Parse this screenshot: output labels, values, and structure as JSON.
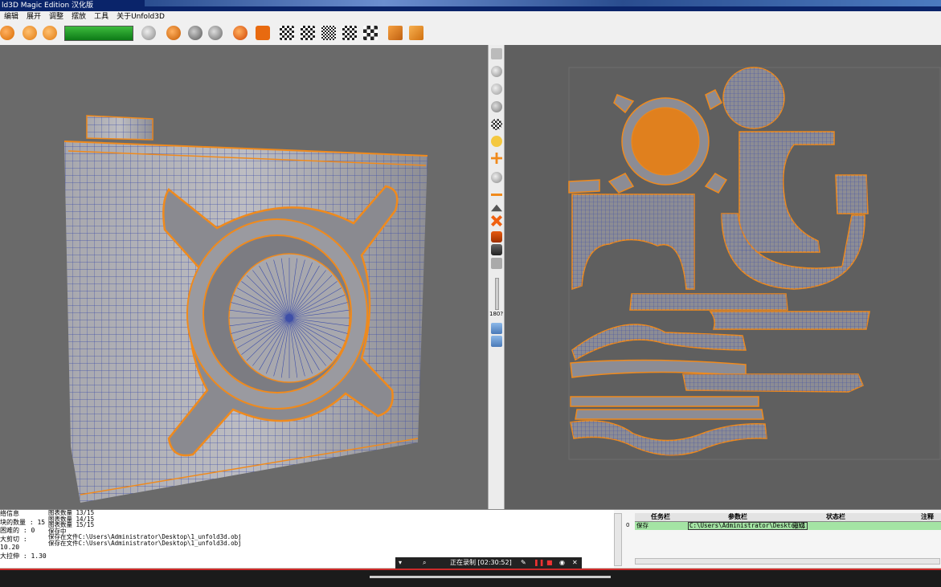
{
  "app": {
    "title": "ld3D Magic Edition 汉化版"
  },
  "menu": [
    "编辑",
    "展开",
    "调整",
    "摆放",
    "工具",
    "关于Unfold3D"
  ],
  "toolbar": {
    "progress_percent": 100
  },
  "sidebar": {
    "zoom_label": "180?"
  },
  "stats": {
    "lines": [
      "络信息",
      "块的数量 : 15",
      "困难的 : 0",
      "大剪切 : 10.20",
      "大拉伸 : 1.30"
    ]
  },
  "log": {
    "lines": [
      "图表数量  13/15",
      "图表数量  14/15",
      "图表数量  15/15",
      "保存中",
      "保存在文件C:\\Users\\Administrator\\Desktop\\1_unfold3d.obj",
      "保存在文件C:\\Users\\Administrator\\Desktop\\1_unfold3d.obj"
    ]
  },
  "tasks": {
    "headers": [
      "任务栏",
      "参数栏",
      "状态栏",
      "注释"
    ],
    "rows": [
      {
        "index": "0",
        "task": "保存",
        "param": "C:\\Users\\Administrator\\Desktop\\1",
        "status": "完成"
      }
    ]
  },
  "recorder": {
    "text": "正在录制 [02:30:52]"
  },
  "colors": {
    "accent_orange": "#f08a1c",
    "mesh_blue": "#3f4fa8",
    "progress_green": "#1f9a2a",
    "task_row_green": "#a4e4a4"
  }
}
